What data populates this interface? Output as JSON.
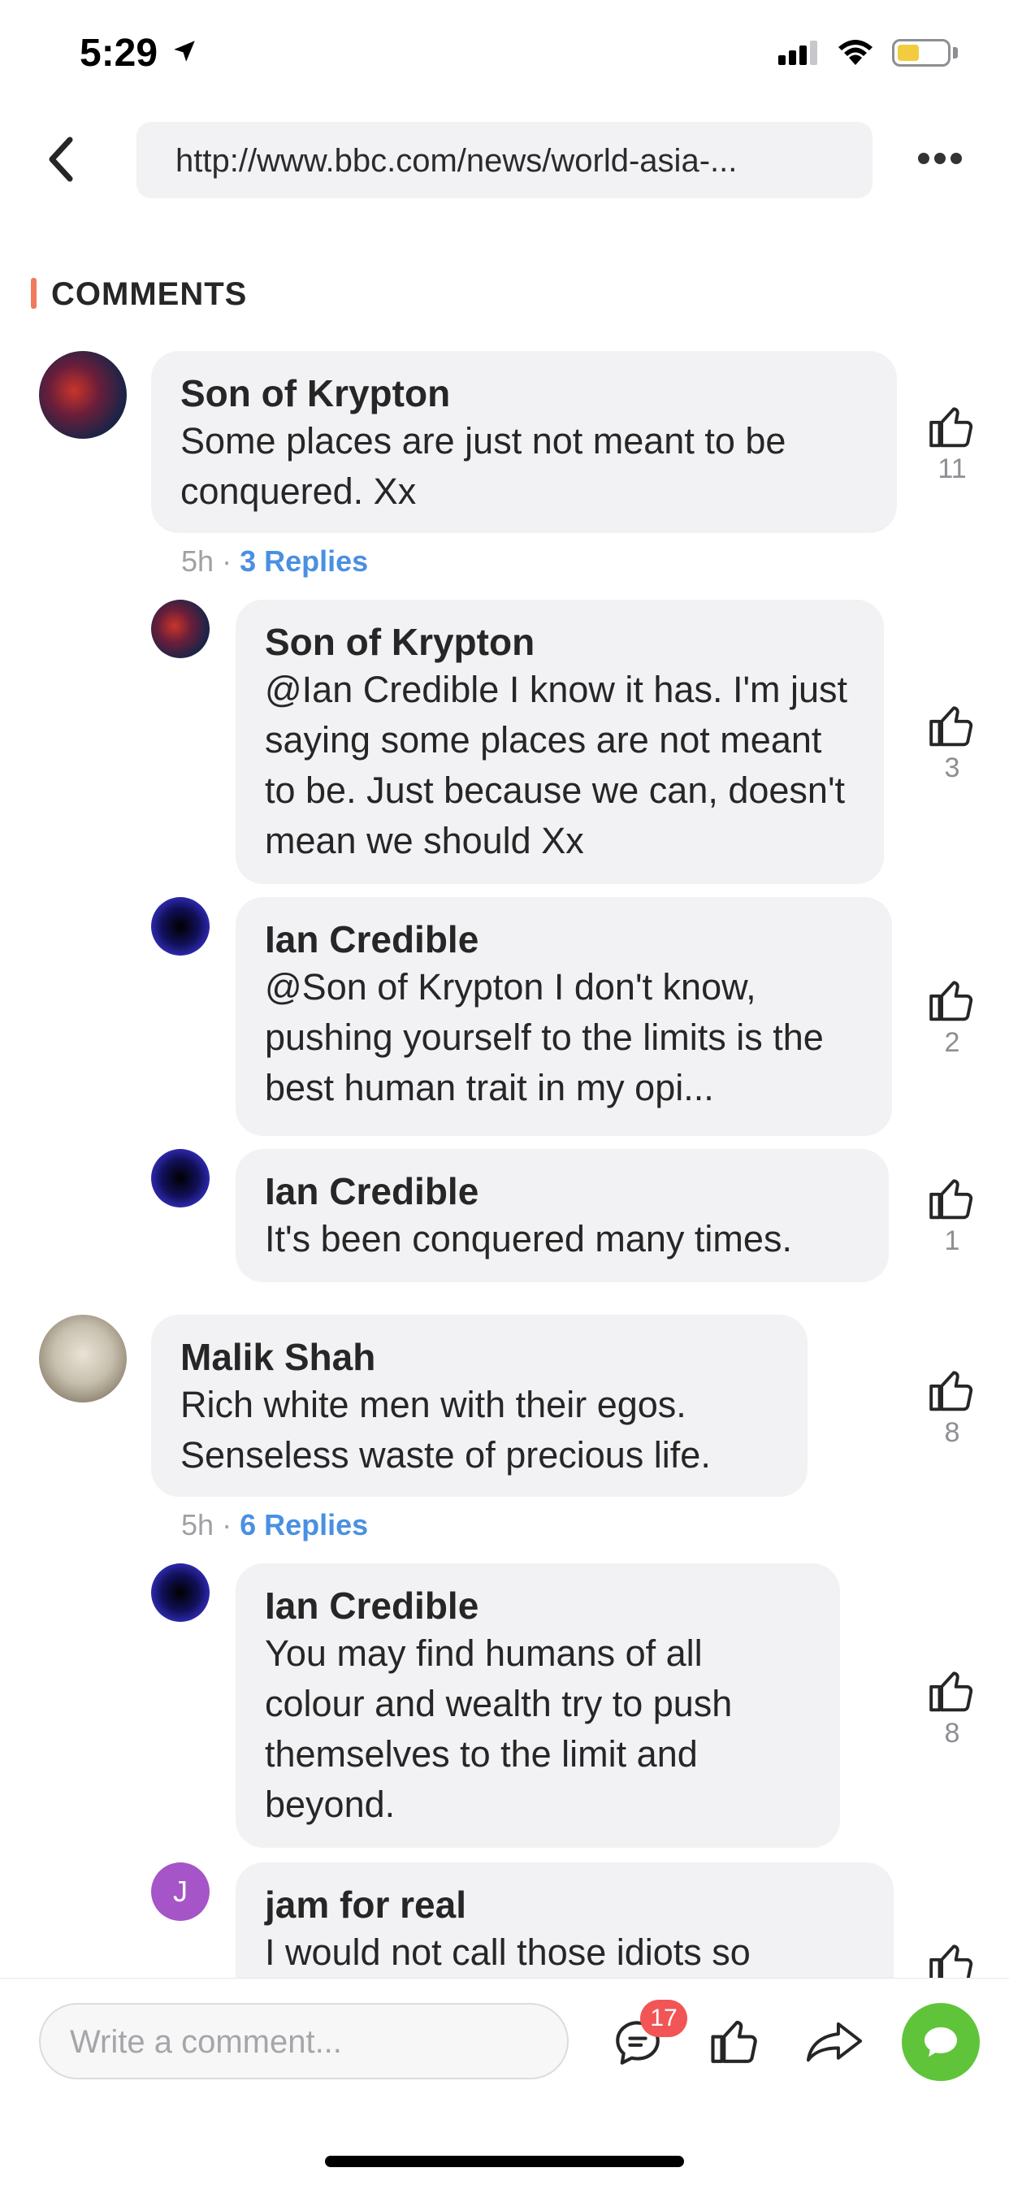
{
  "status_bar": {
    "time": "5:29"
  },
  "nav": {
    "url": "http://www.bbc.com/news/world-asia-..."
  },
  "section": {
    "title": "COMMENTS"
  },
  "comments": [
    {
      "author": "Son of Krypton",
      "text": "Some places are just not meant to be conquered. Xx",
      "likes": "11",
      "time": "5h",
      "replies_label": "3 Replies",
      "replies": [
        {
          "author": "Son of Krypton",
          "text": "@Ian Credible I know it has. I'm just saying some places are not meant to be. Just because we can, doesn't mean we should Xx",
          "likes": "3"
        },
        {
          "author": "Ian Credible",
          "text": "@Son of Krypton I don't know, pushing yourself to the limits is the best human trait in my opi...",
          "likes": "2"
        },
        {
          "author": "Ian Credible",
          "text": "It's been conquered many times.",
          "likes": "1"
        }
      ]
    },
    {
      "author": "Malik Shah",
      "text": "Rich white men with their egos. Senseless waste of precious life.",
      "likes": "8",
      "time": "5h",
      "replies_label": "6 Replies",
      "replies": [
        {
          "author": "Ian Credible",
          "text": "You may find humans of all colour and wealth try to push themselves to the limit and beyond.",
          "likes": "8"
        },
        {
          "author": "jam for real",
          "avatar_letter": "J",
          "text": "I would not call those idiots so"
        }
      ]
    }
  ],
  "meta_separator": "·",
  "bottom_bar": {
    "input_placeholder": "Write a comment...",
    "comment_count_badge": "17"
  },
  "colors": {
    "accent_blue": "#4a90e2",
    "section_marker": "#f07a5c",
    "badge_red": "#f25555",
    "chat_green": "#5fc43a",
    "bubble_bg": "#f2f2f4"
  },
  "icons": [
    "location-arrow-icon",
    "cellular-signal-icon",
    "wifi-icon",
    "battery-icon",
    "back-chevron-icon",
    "more-dots-icon",
    "thumbs-up-icon",
    "chat-bubble-icon",
    "share-arrow-icon",
    "chat-fab-icon"
  ]
}
